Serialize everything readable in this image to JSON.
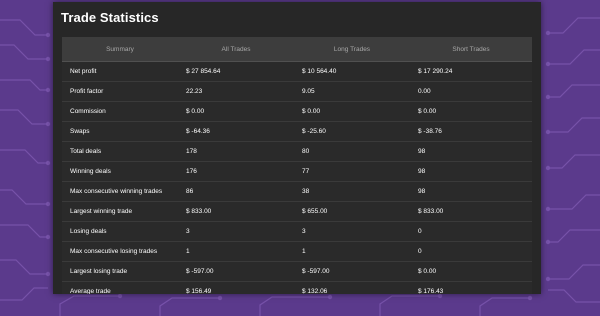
{
  "colors": {
    "background": "#5b3a8c",
    "circuit": "#7a55ad",
    "panel": "#272727",
    "header": "#3d3d3d",
    "text": "#ffffff",
    "header_text": "#a8a8a8"
  },
  "panel": {
    "title": "Trade Statistics"
  },
  "table": {
    "headers": [
      "Summary",
      "All Trades",
      "Long Trades",
      "Short Trades"
    ],
    "rows": [
      {
        "label": "Net profit",
        "all": "$ 27 854.64",
        "long": "$ 10 564.40",
        "short": "$ 17 290.24"
      },
      {
        "label": "Profit factor",
        "all": "22.23",
        "long": "9.05",
        "short": "0.00"
      },
      {
        "label": "Commission",
        "all": "$ 0.00",
        "long": "$ 0.00",
        "short": "$ 0.00"
      },
      {
        "label": "Swaps",
        "all": "$ -64.36",
        "long": "$ -25.60",
        "short": "$ -38.76"
      },
      {
        "label": "Total deals",
        "all": "178",
        "long": "80",
        "short": "98"
      },
      {
        "label": "Winning deals",
        "all": "176",
        "long": "77",
        "short": "98"
      },
      {
        "label": "Max consecutive winning trades",
        "all": "86",
        "long": "38",
        "short": "98"
      },
      {
        "label": "Largest winning trade",
        "all": "$ 833.00",
        "long": "$ 655.00",
        "short": "$ 833.00"
      },
      {
        "label": "Losing deals",
        "all": "3",
        "long": "3",
        "short": "0"
      },
      {
        "label": "Max consecutive losing trades",
        "all": "1",
        "long": "1",
        "short": "0"
      },
      {
        "label": "Largest losing trade",
        "all": "$ -597.00",
        "long": "$ -597.00",
        "short": "$ 0.00"
      },
      {
        "label": "Average trade",
        "all": "$ 156.49",
        "long": "$ 132.06",
        "short": "$ 176.43"
      }
    ]
  }
}
